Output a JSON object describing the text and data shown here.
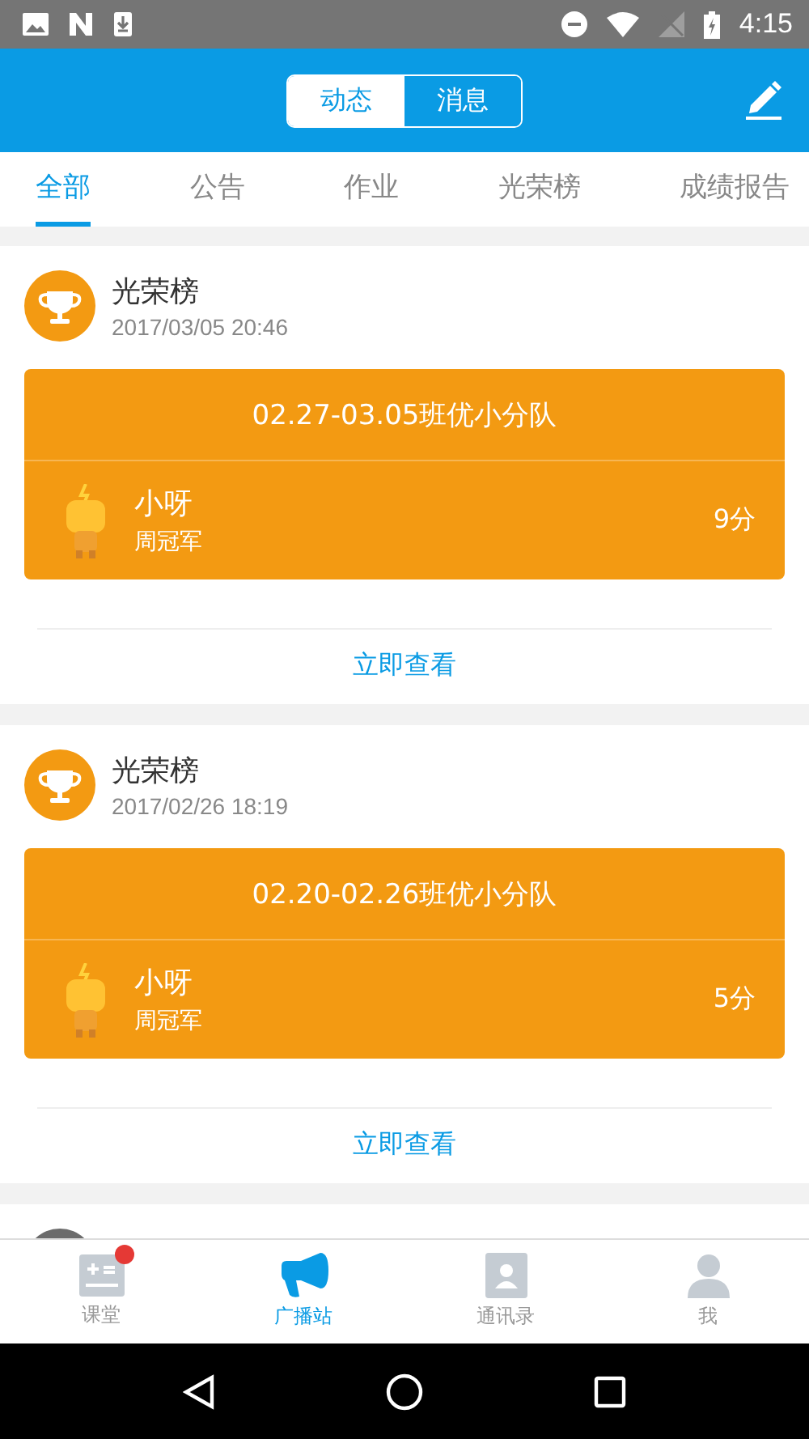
{
  "status_bar": {
    "time": "4:15"
  },
  "header": {
    "segments": [
      {
        "label": "动态",
        "selected": true
      },
      {
        "label": "消息",
        "selected": false
      }
    ]
  },
  "tabs": [
    {
      "label": "全部",
      "selected": true
    },
    {
      "label": "公告",
      "selected": false
    },
    {
      "label": "作业",
      "selected": false
    },
    {
      "label": "光荣榜",
      "selected": false
    },
    {
      "label": "成绩报告",
      "selected": false
    }
  ],
  "posts": [
    {
      "title": "光荣榜",
      "time": "2017/03/05 20:46",
      "banner": "02.27-03.05班优小分队",
      "winner": {
        "name": "小呀",
        "award": "周冠军",
        "score": "9分"
      },
      "link": "立即查看"
    },
    {
      "title": "光荣榜",
      "time": "2017/02/26 18:19",
      "banner": "02.20-02.26班优小分队",
      "winner": {
        "name": "小呀",
        "award": "周冠军",
        "score": "5分"
      },
      "link": "立即查看"
    }
  ],
  "bottom_nav": [
    {
      "kind": "board",
      "label": "课堂",
      "selected": false,
      "badge": true
    },
    {
      "kind": "megaphone",
      "label": "广播站",
      "selected": true,
      "badge": false
    },
    {
      "kind": "contacts",
      "label": "通讯录",
      "selected": false,
      "badge": false
    },
    {
      "kind": "person",
      "label": "我",
      "selected": false,
      "badge": false
    }
  ]
}
